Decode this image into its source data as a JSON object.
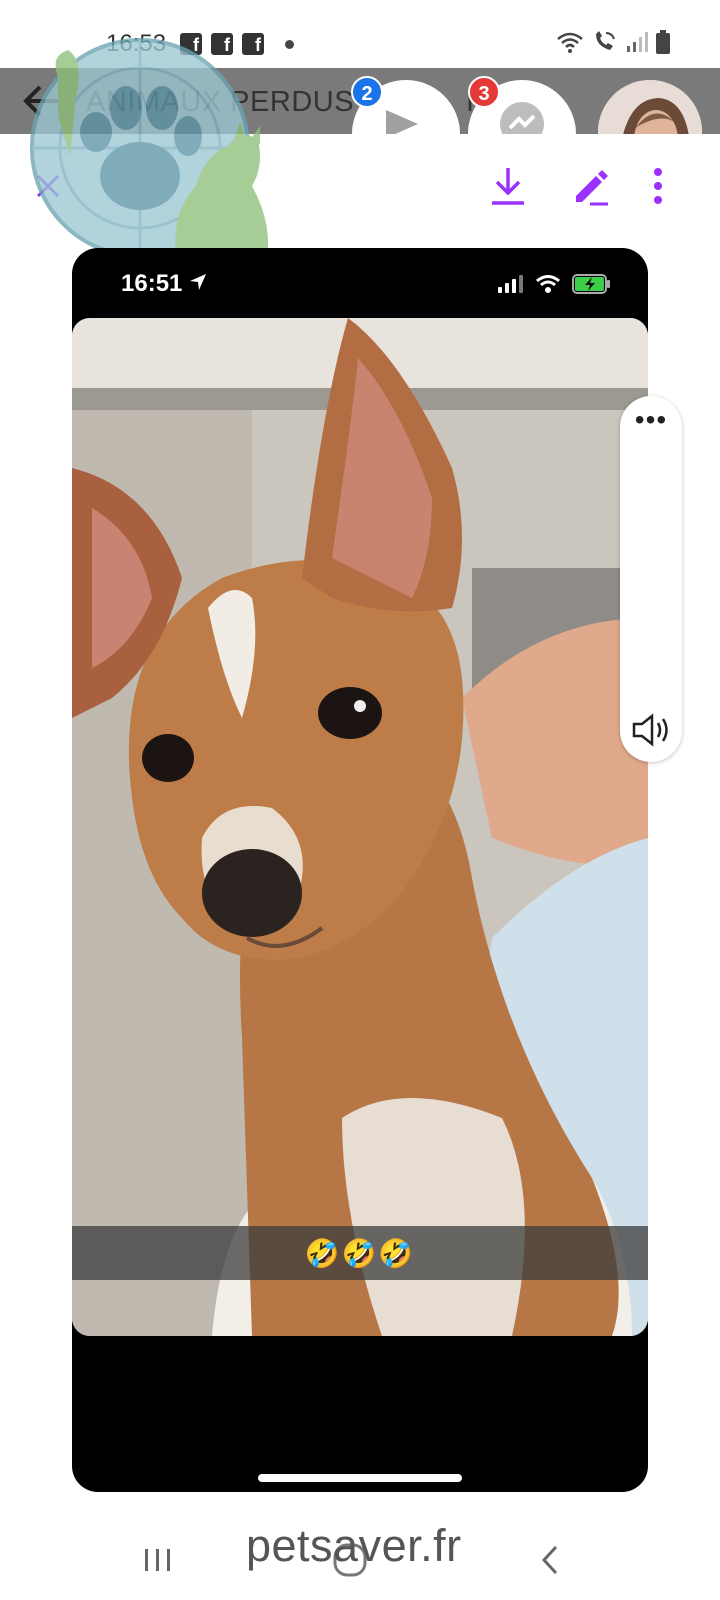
{
  "status_bar": {
    "time": "16:53",
    "notification_icons": [
      "facebook-icon",
      "facebook-icon",
      "facebook-icon",
      "dot-icon"
    ],
    "right_icons": [
      "wifi-icon",
      "wifi-call-icon",
      "signal-icon",
      "battery-icon"
    ]
  },
  "group_header": {
    "title": "ANIMAUX PERDUS",
    "title_tail": "IV",
    "bubble_1_badge": "2",
    "bubble_2_badge": "3",
    "badge_color_blue": "#1a73e8",
    "badge_color_red": "#e53935"
  },
  "toolbar": {
    "close_icon": "close-icon",
    "download_icon": "download-icon",
    "edit_icon": "pencil-icon",
    "more_icon": "more-vertical-icon",
    "accent_color": "#9b30ff"
  },
  "embedded_screenshot": {
    "time": "16:51",
    "status_icons": [
      "location-arrow-icon",
      "signal-icon",
      "wifi-icon",
      "battery-charging-icon"
    ],
    "caption": "🤣🤣🤣"
  },
  "side_panel": {
    "more_label": "•••",
    "volume_icon": "volume-icon"
  },
  "footer": {
    "watermark": "petsaver.fr"
  },
  "nav_bar": {
    "icons": [
      "recent-apps-icon",
      "home-icon",
      "back-icon"
    ]
  }
}
